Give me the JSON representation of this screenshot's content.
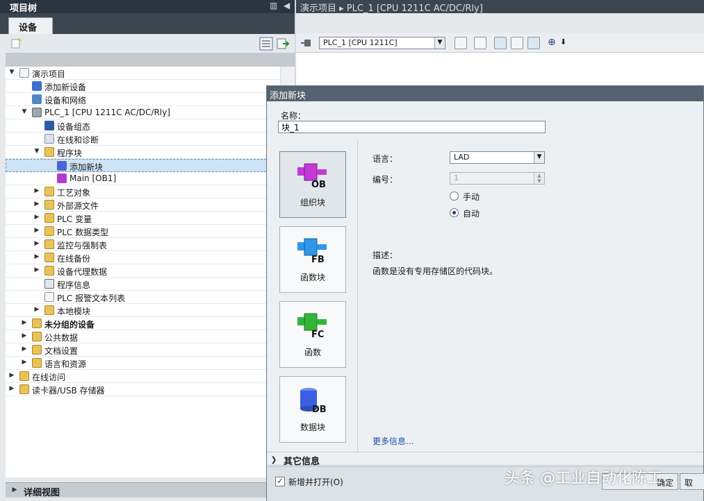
{
  "project_tree": {
    "title": "项目树",
    "tab": "设备",
    "rows": [
      {
        "label": "演示项目",
        "icon": "project-icon"
      },
      {
        "label": "添加新设备",
        "icon": "add-device-icon"
      },
      {
        "label": "设备和网络",
        "icon": "network-icon"
      },
      {
        "label": "PLC_1 [CPU 1211C AC/DC/Rly]",
        "icon": "plc-icon"
      },
      {
        "label": "设备组态",
        "icon": "device-config-icon"
      },
      {
        "label": "在线和诊断",
        "icon": "diagnostics-icon"
      },
      {
        "label": "程序块",
        "icon": "folder-icon"
      },
      {
        "label": "添加新块",
        "icon": "add-block-icon"
      },
      {
        "label": "Main [OB1]",
        "icon": "ob-block-icon"
      },
      {
        "label": "工艺对象",
        "icon": "folder-icon"
      },
      {
        "label": "外部源文件",
        "icon": "folder-icon"
      },
      {
        "label": "PLC 变量",
        "icon": "folder-icon"
      },
      {
        "label": "PLC 数据类型",
        "icon": "folder-icon"
      },
      {
        "label": "监控与强制表",
        "icon": "folder-icon"
      },
      {
        "label": "在线备份",
        "icon": "folder-icon"
      },
      {
        "label": "设备代理数据",
        "icon": "folder-icon"
      },
      {
        "label": "程序信息",
        "icon": "program-info-icon"
      },
      {
        "label": "PLC 报警文本列表",
        "icon": "alarm-text-icon"
      },
      {
        "label": "本地模块",
        "icon": "folder-icon"
      },
      {
        "label": "未分组的设备",
        "icon": "folder-icon"
      },
      {
        "label": "公共数据",
        "icon": "folder-icon"
      },
      {
        "label": "文档设置",
        "icon": "folder-icon"
      },
      {
        "label": "语言和资源",
        "icon": "folder-icon"
      },
      {
        "label": "在线访问",
        "icon": "folder-icon"
      },
      {
        "label": "读卡器/USB 存储器",
        "icon": "folder-icon"
      }
    ],
    "detail_view": "详细视图"
  },
  "editor": {
    "title": "演示项目 ▸ PLC_1 [CPU 1211C AC/DC/Rly]",
    "device_select": "PLC_1 [CPU 1211C]"
  },
  "dialog": {
    "title": "添加新块",
    "name_label": "名称：",
    "name_value": "块_1",
    "block_types": [
      {
        "label": "组织块",
        "code": "OB",
        "color": "#c23bd4"
      },
      {
        "label": "函数块",
        "code": "FB",
        "color": "#2f96e8"
      },
      {
        "label": "函数",
        "code": "FC",
        "color": "#33b53a"
      },
      {
        "label": "数据块",
        "code": "DB",
        "color": "#3b5fe0"
      }
    ],
    "language_label": "语言：",
    "language_value": "LAD",
    "number_label": "编号：",
    "number_value": "1",
    "manual_label": "手动",
    "auto_label": "自动",
    "description_label": "描述：",
    "description_text": "函数是没有专用存储区的代码块。",
    "more_info": "更多信息...",
    "other_info": "其它信息",
    "add_open_label": "新增并打开(O)",
    "ok_label": "确定",
    "cancel_label": "取"
  },
  "watermark": "头条 @工业自动化陈工"
}
